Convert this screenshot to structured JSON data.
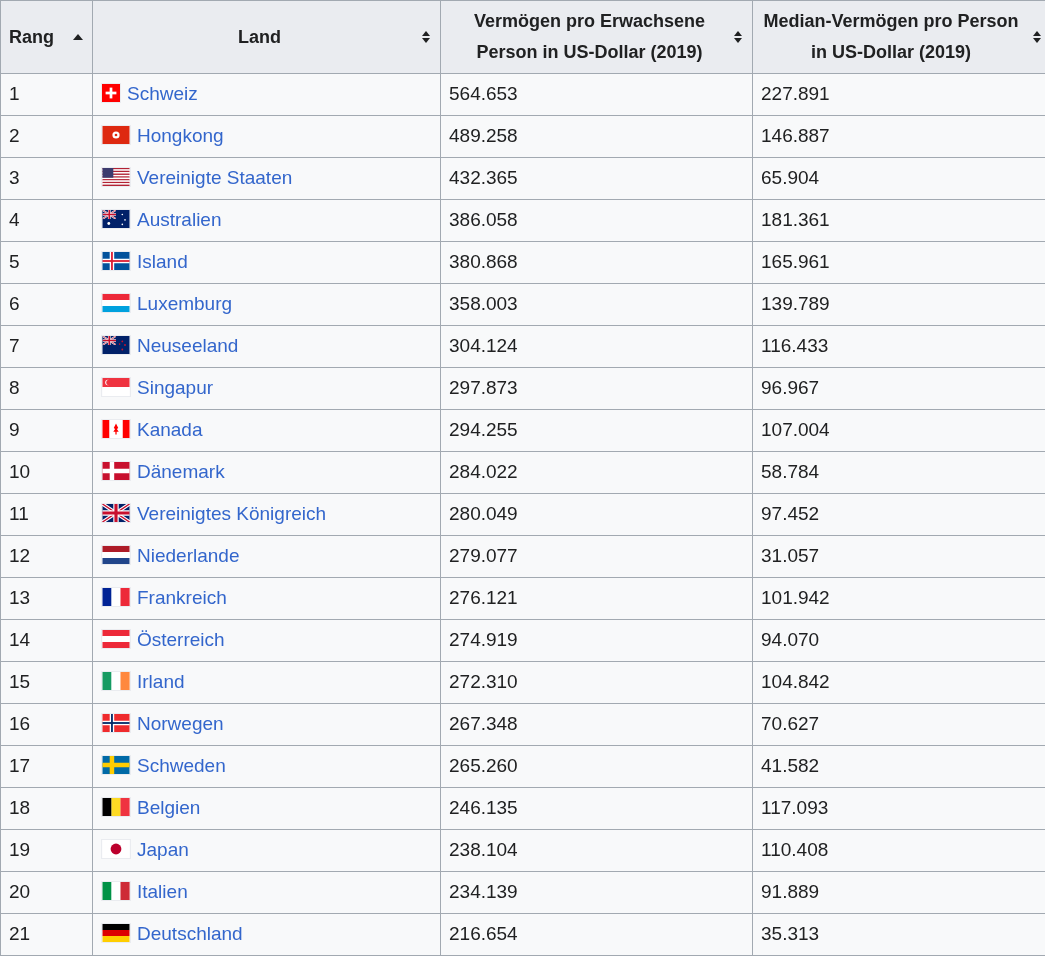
{
  "table": {
    "columns": [
      {
        "label": "Rang",
        "sorted": true
      },
      {
        "label": "Land",
        "sorted": false
      },
      {
        "label": "Vermögen pro Erwachsene Person in US-Dollar (2019)",
        "sorted": false
      },
      {
        "label": "Median-Vermögen pro Person in US-Dollar (2019)",
        "sorted": false
      }
    ],
    "rows": [
      {
        "rank": "1",
        "country": "Schweiz",
        "wealth": "564.653",
        "median": "227.891"
      },
      {
        "rank": "2",
        "country": "Hongkong",
        "wealth": "489.258",
        "median": "146.887"
      },
      {
        "rank": "3",
        "country": "Vereinigte Staaten",
        "wealth": "432.365",
        "median": "65.904"
      },
      {
        "rank": "4",
        "country": "Australien",
        "wealth": "386.058",
        "median": "181.361"
      },
      {
        "rank": "5",
        "country": "Island",
        "wealth": "380.868",
        "median": "165.961"
      },
      {
        "rank": "6",
        "country": "Luxemburg",
        "wealth": "358.003",
        "median": "139.789"
      },
      {
        "rank": "7",
        "country": "Neuseeland",
        "wealth": "304.124",
        "median": "116.433"
      },
      {
        "rank": "8",
        "country": "Singapur",
        "wealth": "297.873",
        "median": "96.967"
      },
      {
        "rank": "9",
        "country": "Kanada",
        "wealth": "294.255",
        "median": "107.004"
      },
      {
        "rank": "10",
        "country": "Dänemark",
        "wealth": "284.022",
        "median": "58.784"
      },
      {
        "rank": "11",
        "country": "Vereinigtes Königreich",
        "wealth": "280.049",
        "median": "97.452"
      },
      {
        "rank": "12",
        "country": "Niederlande",
        "wealth": "279.077",
        "median": "31.057"
      },
      {
        "rank": "13",
        "country": "Frankreich",
        "wealth": "276.121",
        "median": "101.942"
      },
      {
        "rank": "14",
        "country": "Österreich",
        "wealth": "274.919",
        "median": "94.070"
      },
      {
        "rank": "15",
        "country": "Irland",
        "wealth": "272.310",
        "median": "104.842"
      },
      {
        "rank": "16",
        "country": "Norwegen",
        "wealth": "267.348",
        "median": "70.627"
      },
      {
        "rank": "17",
        "country": "Schweden",
        "wealth": "265.260",
        "median": "41.582"
      },
      {
        "rank": "18",
        "country": "Belgien",
        "wealth": "246.135",
        "median": "117.093"
      },
      {
        "rank": "19",
        "country": "Japan",
        "wealth": "238.104",
        "median": "110.408"
      },
      {
        "rank": "20",
        "country": "Italien",
        "wealth": "234.139",
        "median": "91.889"
      },
      {
        "rank": "21",
        "country": "Deutschland",
        "wealth": "216.654",
        "median": "35.313"
      }
    ]
  }
}
